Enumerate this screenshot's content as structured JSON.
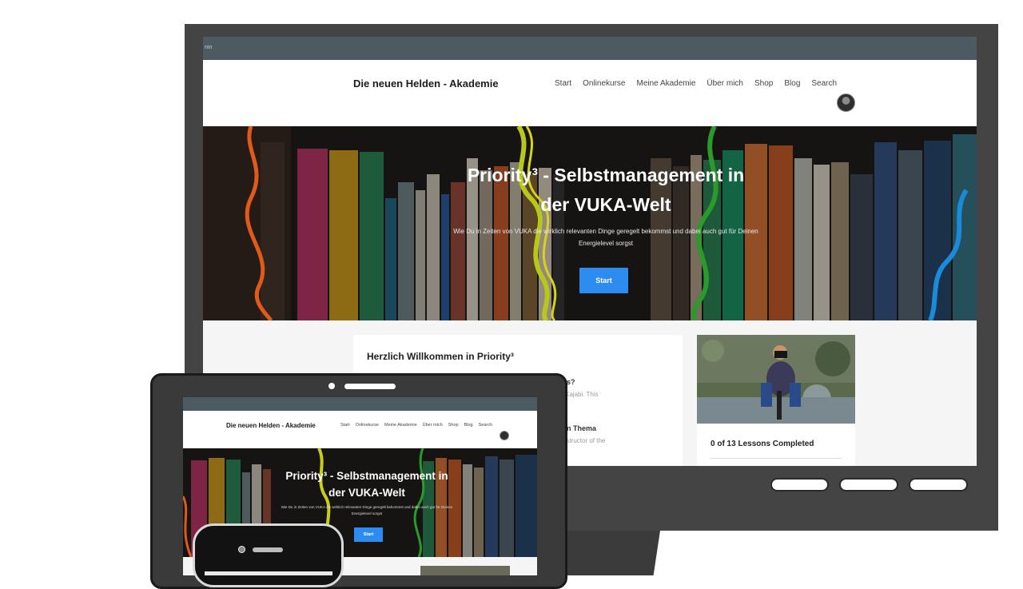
{
  "desktop": {
    "topbar_text": "nin",
    "brand": "Die neuen Helden - Akademie",
    "nav": [
      "Start",
      "Onlinekurse",
      "Meine Akademie",
      "Über mich",
      "Shop",
      "Blog",
      "Search"
    ],
    "hero": {
      "title_line1": "Priority³ - Selbstmanagement in",
      "title_line2": "der VUKA-Welt",
      "subtitle": "Wie Du in Zeiten von VUKA die wirklich relevanten Dinge geregelt bekommst und dabei auch gut für Deinen Energielevel sorgst",
      "button": "Start"
    },
    "content": {
      "heading": "Herzlich Willkommen in Priority³",
      "frag1": "as?",
      "frag2": "Kajabi. This",
      "frag3": "n Thema",
      "frag4": "nstructor of the"
    },
    "sidebar": {
      "progress_text": "0 of 13 Lessons Completed",
      "lessons_completed": 0,
      "lessons_total": 13
    }
  },
  "tablet": {
    "brand": "Die neuen Helden - Akademie",
    "nav": [
      "Start",
      "Onlinekurse",
      "Meine Akademie",
      "Über mich",
      "Shop",
      "Blog",
      "Search"
    ],
    "hero": {
      "title_line1": "Priority³ - Selbstmanagement in",
      "title_line2": "der VUKA-Welt",
      "subtitle": "Wie Du in Zeiten von VUKA die wirklich relevanten Dinge geregelt bekommst und dabei auch gut für Deinen Energielevel sorgst",
      "button": "Start"
    }
  },
  "colors": {
    "accent": "#2d8cf0",
    "device_frame": "#444444",
    "topbar": "#4e5a62"
  }
}
